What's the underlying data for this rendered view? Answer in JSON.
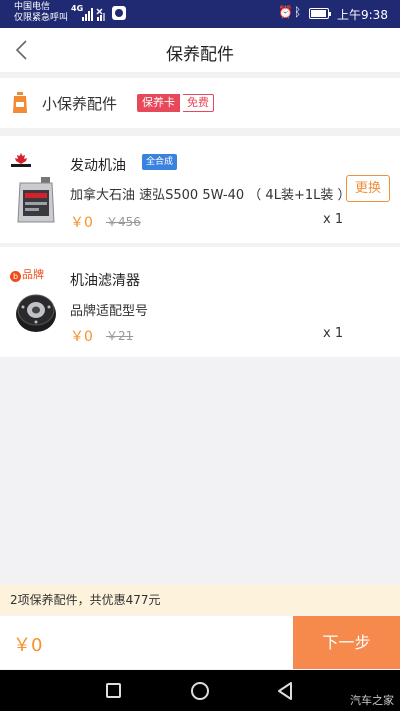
{
  "status_bar": {
    "carrier_line1": "中国电信",
    "carrier_line2": "仅限紧急呼叫",
    "network": "4G",
    "time": "上午9:38"
  },
  "nav": {
    "title": "保养配件",
    "back_icon": "chevron-left-icon"
  },
  "kit": {
    "title": "小保养配件",
    "tag_card": "保养卡",
    "tag_free": "免费"
  },
  "items": [
    {
      "name": "发动机油",
      "badge": "全合成",
      "description": "加拿大石油 速弘S500 5W-40 （ 4L装+1L装 ）",
      "price": "￥0",
      "original_price": "￥456",
      "quantity": "x 1",
      "action": "更换"
    },
    {
      "brand_tag": "品牌",
      "name": "机油滤清器",
      "description": "品牌适配型号",
      "price": "￥0",
      "original_price": "￥21",
      "quantity": "x 1"
    }
  ],
  "summary": "2项保养配件，共优惠477元",
  "footer": {
    "total": "￥0",
    "next_label": "下一步"
  },
  "watermark": "汽车之家",
  "colors": {
    "status_bar": "#1f2a72",
    "accent_orange": "#f58a4c",
    "price_orange": "#f5932c",
    "tag_red": "#e8495a",
    "badge_blue": "#3a82e0",
    "summary_bg": "#fdf2dc"
  }
}
